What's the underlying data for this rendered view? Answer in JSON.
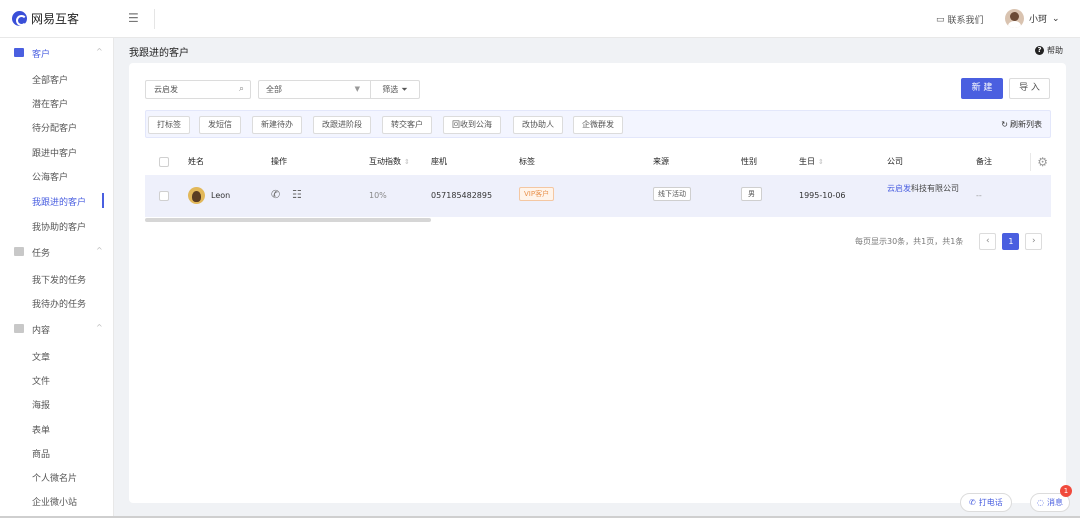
{
  "app": {
    "logo_text": "网易互客"
  },
  "topbar": {
    "contact_label": "联系我们",
    "user_name": "小珂"
  },
  "sidebar": {
    "groups": [
      {
        "label": "客户",
        "icon": "id-card-icon",
        "items": [
          "全部客户",
          "潜在客户",
          "待分配客户",
          "跟进中客户",
          "公海客户",
          "我跟进的客户",
          "我协助的客户"
        ]
      },
      {
        "label": "任务",
        "icon": "task-icon",
        "items": [
          "我下发的任务",
          "我待办的任务"
        ]
      },
      {
        "label": "内容",
        "icon": "document-icon",
        "items": [
          "文章",
          "文件",
          "海报",
          "表单",
          "商品",
          "个人微名片",
          "企业微小站"
        ]
      }
    ],
    "active_item": "我跟进的客户",
    "accent_color": "#4a5fe0"
  },
  "page": {
    "title": "我跟进的客户",
    "help_label": "帮助"
  },
  "filters": {
    "search_value": "云启发",
    "select_value": "全部",
    "filter_label": "筛选"
  },
  "buttons": {
    "new_label": "新 建",
    "import_label": "导 入"
  },
  "bulk_actions": [
    "打标签",
    "发短信",
    "新建待办",
    "改跟进阶段",
    "转交客户",
    "回收到公海",
    "改协助人",
    "企微群发"
  ],
  "refresh_label": "刷新列表",
  "table": {
    "columns": [
      "姓名",
      "操作",
      "互动指数",
      "座机",
      "标签",
      "来源",
      "性别",
      "生日",
      "公司",
      "备注"
    ],
    "rows": [
      {
        "name": "Leon",
        "interaction": "10%",
        "landline": "057185482895",
        "tag": "VIP客户",
        "source": "线下活动",
        "gender": "男",
        "birthday": "1995-10-06",
        "company_highlight": "云启发",
        "company_rest": "科技有限公司",
        "remark": "--"
      }
    ]
  },
  "pagination": {
    "summary": "每页显示30条，共1页，共1条",
    "current_page": "1"
  },
  "floating": {
    "call_label": "打电话",
    "message_label": "消息",
    "message_badge": "1"
  }
}
